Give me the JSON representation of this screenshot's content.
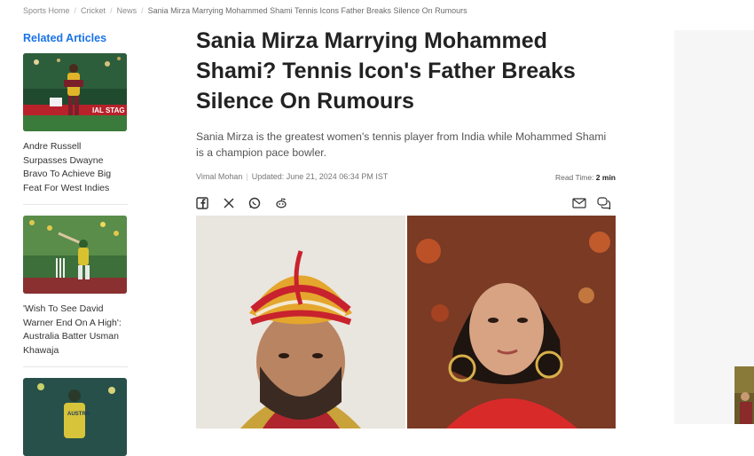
{
  "breadcrumb": {
    "items": [
      "Sports Home",
      "Cricket",
      "News"
    ],
    "current": "Sania Mirza Marrying Mohammed Shami Tennis Icons Father Breaks Silence On Rumours",
    "separator": "/"
  },
  "sidebar": {
    "heading": "Related Articles",
    "articles": [
      {
        "title": "Andre Russell Surpasses Dwayne Bravo To Achieve Big Feat For West Indies"
      },
      {
        "title": "'Wish To See David Warner End On A High': Australia Batter Usman Khawaja"
      },
      {
        "title": ""
      }
    ]
  },
  "article": {
    "headline": "Sania Mirza Marrying Mohammed Shami? Tennis Icon's Father Breaks Silence On Rumours",
    "summary": "Sania Mirza is the greatest women's tennis player from India while Mohammed Shami is a champion pace bowler.",
    "author": "Vimal Mohan",
    "updated": "Updated: June 21, 2024 06:34 PM IST",
    "read_time_label": "Read Time:",
    "read_time_value": "2 min"
  },
  "share": {
    "icons": [
      "facebook-icon",
      "x-icon",
      "whatsapp-icon",
      "reddit-icon",
      "mail-icon",
      "comment-icon"
    ]
  },
  "colors": {
    "accent": "#1a73e8",
    "text": "#222222",
    "muted": "#8a8a8a"
  }
}
